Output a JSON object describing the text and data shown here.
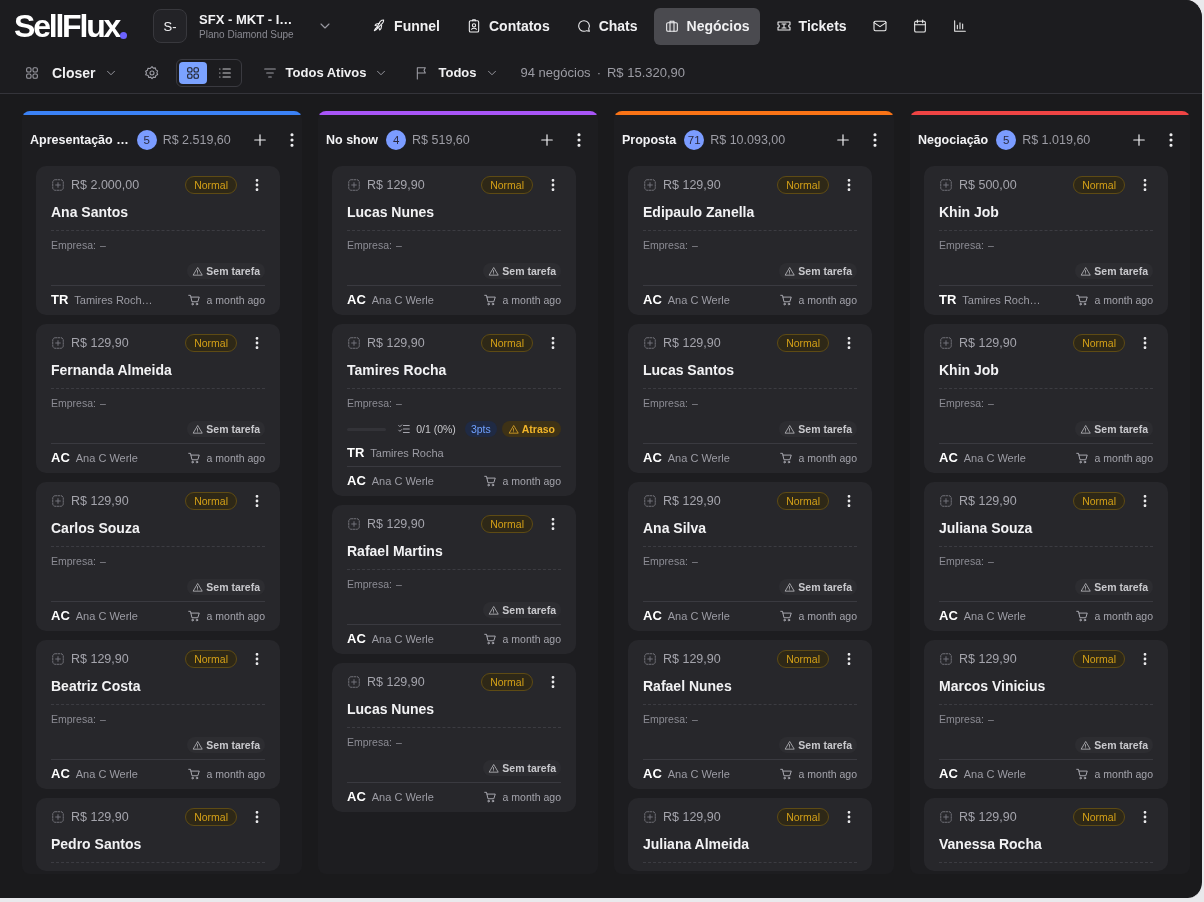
{
  "header": {
    "logo": "SellFlux",
    "workspace": {
      "avatar": "S-",
      "name": "SFX - MKT - I…",
      "plan": "Plano Diamond Supe"
    },
    "nav": [
      {
        "label": "Funnel",
        "selected": false
      },
      {
        "label": "Contatos",
        "selected": false
      },
      {
        "label": "Chats",
        "selected": false
      },
      {
        "label": "Negócios",
        "selected": true
      },
      {
        "label": "Tickets",
        "selected": false
      }
    ],
    "nav_icons": [
      {
        "selected": false
      },
      {
        "selected": false
      },
      {
        "selected": false
      }
    ]
  },
  "toolbar": {
    "pipeline": "Closer",
    "views": [
      {
        "selected": true
      },
      {
        "selected": false
      }
    ],
    "status_filter": "Todos Ativos",
    "flag_filter": "Todos",
    "count": "94 negócios",
    "separator": "·",
    "total": "R$ 15.320,90"
  },
  "columns": [
    {
      "name": "Apresentação …",
      "color": "#3b82f6",
      "count": "5",
      "total": "R$ 2.519,60",
      "cards": [
        {
          "value": "R$ 2.000,00",
          "priority": "Normal",
          "name": "Ana Santos",
          "company_label": "Empresa:",
          "company": "–",
          "task": "Sem tarefa",
          "owner_initials": "TR",
          "owner": "Tamires Roch…",
          "time": "a month ago"
        },
        {
          "value": "R$ 129,90",
          "priority": "Normal",
          "name": "Fernanda Almeida",
          "company_label": "Empresa:",
          "company": "–",
          "task": "Sem tarefa",
          "owner_initials": "AC",
          "owner": "Ana C Werle",
          "time": "a month ago"
        },
        {
          "value": "R$ 129,90",
          "priority": "Normal",
          "name": "Carlos Souza",
          "company_label": "Empresa:",
          "company": "–",
          "task": "Sem tarefa",
          "owner_initials": "AC",
          "owner": "Ana C Werle",
          "time": "a month ago"
        },
        {
          "value": "R$ 129,90",
          "priority": "Normal",
          "name": "Beatriz Costa",
          "company_label": "Empresa:",
          "company": "–",
          "task": "Sem tarefa",
          "owner_initials": "AC",
          "owner": "Ana C Werle",
          "time": "a month ago"
        },
        {
          "value": "R$ 129,90",
          "priority": "Normal",
          "name": "Pedro Santos"
        }
      ]
    },
    {
      "name": "No show",
      "color": "#a855f7",
      "count": "4",
      "total": "R$ 519,60",
      "cards": [
        {
          "value": "R$ 129,90",
          "priority": "Normal",
          "name": "Lucas Nunes",
          "company_label": "Empresa:",
          "company": "–",
          "task": "Sem tarefa",
          "owner_initials": "AC",
          "owner": "Ana C Werle",
          "time": "a month ago"
        },
        {
          "value": "R$ 129,90",
          "priority": "Normal",
          "name": "Tamires Rocha",
          "company_label": "Empresa:",
          "company": "–",
          "checklist": {
            "level": 0,
            "text": "0/1 (0%)"
          },
          "points": "3pts",
          "alert": "Atraso",
          "contact": {
            "initials": "TR",
            "name": "Tamires Rocha"
          },
          "owner_initials": "AC",
          "owner": "Ana C Werle",
          "time": "a month ago"
        },
        {
          "value": "R$ 129,90",
          "priority": "Normal",
          "name": "Rafael Martins",
          "company_label": "Empresa:",
          "company": "–",
          "task": "Sem tarefa",
          "owner_initials": "AC",
          "owner": "Ana C Werle",
          "time": "a month ago"
        },
        {
          "value": "R$ 129,90",
          "priority": "Normal",
          "name": "Lucas Nunes",
          "company_label": "Empresa:",
          "company": "–",
          "task": "Sem tarefa",
          "owner_initials": "AC",
          "owner": "Ana C Werle",
          "time": "a month ago"
        }
      ]
    },
    {
      "name": "Proposta",
      "color": "#f97316",
      "count": "71",
      "total": "R$ 10.093,00",
      "cards": [
        {
          "value": "R$ 129,90",
          "priority": "Normal",
          "name": "Edipaulo Zanella",
          "company_label": "Empresa:",
          "company": "–",
          "task": "Sem tarefa",
          "owner_initials": "AC",
          "owner": "Ana C Werle",
          "time": "a month ago"
        },
        {
          "value": "R$ 129,90",
          "priority": "Normal",
          "name": "Lucas Santos",
          "company_label": "Empresa:",
          "company": "–",
          "task": "Sem tarefa",
          "owner_initials": "AC",
          "owner": "Ana C Werle",
          "time": "a month ago"
        },
        {
          "value": "R$ 129,90",
          "priority": "Normal",
          "name": "Ana Silva",
          "company_label": "Empresa:",
          "company": "–",
          "task": "Sem tarefa",
          "owner_initials": "AC",
          "owner": "Ana C Werle",
          "time": "a month ago"
        },
        {
          "value": "R$ 129,90",
          "priority": "Normal",
          "name": "Rafael Nunes",
          "company_label": "Empresa:",
          "company": "–",
          "task": "Sem tarefa",
          "owner_initials": "AC",
          "owner": "Ana C Werle",
          "time": "a month ago"
        },
        {
          "value": "R$ 129,90",
          "priority": "Normal",
          "name": "Juliana Almeida"
        }
      ]
    },
    {
      "name": "Negociação",
      "color": "#ef4444",
      "count": "5",
      "total": "R$ 1.019,60",
      "cards": [
        {
          "value": "R$ 500,00",
          "priority": "Normal",
          "name": "Khin Job",
          "company_label": "Empresa:",
          "company": "–",
          "task": "Sem tarefa",
          "owner_initials": "TR",
          "owner": "Tamires Roch…",
          "time": "a month ago"
        },
        {
          "value": "R$ 129,90",
          "priority": "Normal",
          "name": "Khin Job",
          "company_label": "Empresa:",
          "company": "–",
          "task": "Sem tarefa",
          "owner_initials": "AC",
          "owner": "Ana C Werle",
          "time": "a month ago"
        },
        {
          "value": "R$ 129,90",
          "priority": "Normal",
          "name": "Juliana Souza",
          "company_label": "Empresa:",
          "company": "–",
          "task": "Sem tarefa",
          "owner_initials": "AC",
          "owner": "Ana C Werle",
          "time": "a month ago"
        },
        {
          "value": "R$ 129,90",
          "priority": "Normal",
          "name": "Marcos Vinicius",
          "company_label": "Empresa:",
          "company": "–",
          "task": "Sem tarefa",
          "owner_initials": "AC",
          "owner": "Ana C Werle",
          "time": "a month ago"
        },
        {
          "value": "R$ 129,90",
          "priority": "Normal",
          "name": "Vanessa Rocha"
        }
      ]
    }
  ]
}
